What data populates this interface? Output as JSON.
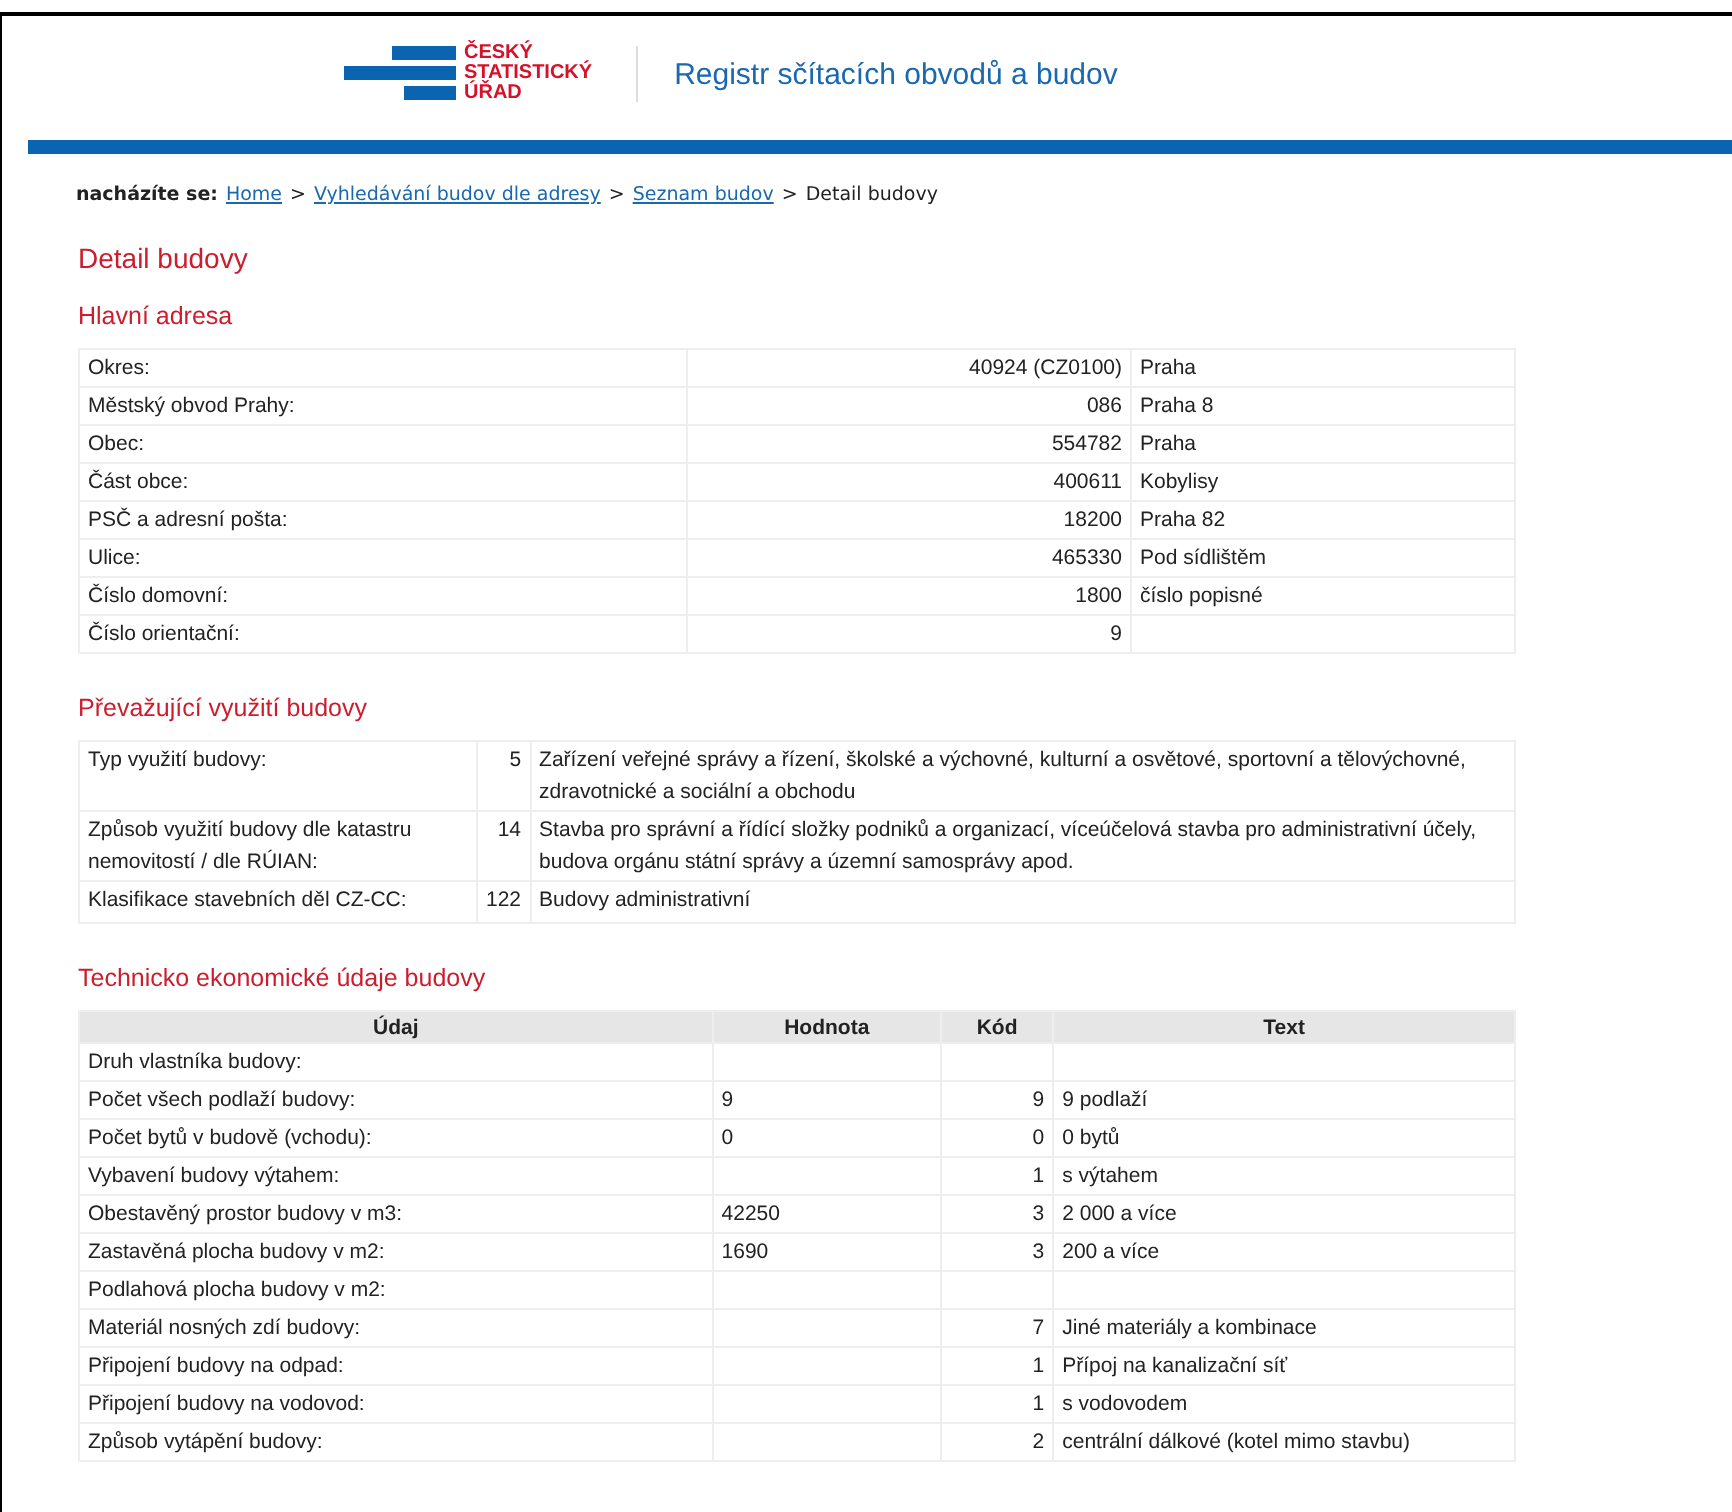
{
  "header": {
    "logo_lines": [
      "ČESKÝ",
      "STATISTICKÝ",
      "ÚŘAD"
    ],
    "title": "Registr sčítacích obvodů a budov"
  },
  "breadcrumb": {
    "label": "nacházíte se:",
    "links": [
      "Home",
      "Vyhledávání budov dle adresy",
      "Seznam budov"
    ],
    "separator": ">",
    "current": "Detail budovy"
  },
  "page_title": "Detail budovy",
  "address": {
    "title": "Hlavní adresa",
    "rows": [
      {
        "label": "Okres:",
        "code": "40924 (CZ0100)",
        "text": "Praha"
      },
      {
        "label": "Městský obvod Prahy:",
        "code": "086",
        "text": "Praha 8"
      },
      {
        "label": "Obec:",
        "code": "554782",
        "text": "Praha"
      },
      {
        "label": "Část obce:",
        "code": "400611",
        "text": "Kobylisy"
      },
      {
        "label": "PSČ a adresní pošta:",
        "code": "18200",
        "text": "Praha 82"
      },
      {
        "label": "Ulice:",
        "code": "465330",
        "text": "Pod sídlištěm"
      },
      {
        "label": "Číslo domovní:",
        "code": "1800",
        "text": "číslo popisné"
      },
      {
        "label": "Číslo orientační:",
        "code": "9",
        "text": ""
      }
    ]
  },
  "usage": {
    "title": "Převažující využití budovy",
    "rows": [
      {
        "label": "Typ využití budovy:",
        "code": "5",
        "text": "Zařízení veřejné správy a řízení, školské a výchovné, kulturní a osvětové, sportovní a tělovýchovné, zdravotnické a sociální a obchodu"
      },
      {
        "label": "Způsob využití budovy dle katastru nemovitostí / dle RÚIAN:",
        "code": "14",
        "text": "Stavba pro správní a řídící složky podniků a organizací, víceúčelová stavba pro administrativní účely, budova orgánu státní správy a územní samosprávy apod."
      },
      {
        "label": "Klasifikace stavebních děl CZ-CC:",
        "code": "122",
        "text": "Budovy administrativní"
      }
    ]
  },
  "technical": {
    "title": "Technicko ekonomické údaje budovy",
    "columns": [
      "Údaj",
      "Hodnota",
      "Kód",
      "Text"
    ],
    "rows": [
      [
        "Druh vlastníka budovy:",
        "",
        "",
        ""
      ],
      [
        "Počet všech podlaží budovy:",
        "9",
        "9",
        "9 podlaží"
      ],
      [
        "Počet bytů v budově (vchodu):",
        "0",
        "0",
        "0 bytů"
      ],
      [
        "Vybavení budovy výtahem:",
        "",
        "1",
        "s výtahem"
      ],
      [
        "Obestavěný prostor budovy v m3:",
        "42250",
        "3",
        "2 000 a více"
      ],
      [
        "Zastavěná plocha budovy v m2:",
        "1690",
        "3",
        "200 a více"
      ],
      [
        "Podlahová plocha budovy v m2:",
        "",
        "",
        ""
      ],
      [
        "Materiál nosných zdí budovy:",
        "",
        "7",
        "Jiné materiály a kombinace"
      ],
      [
        "Připojení budovy na odpad:",
        "",
        "1",
        "Přípoj na kanalizační síť"
      ],
      [
        "Připojení budovy na vodovod:",
        "",
        "1",
        "s vodovodem"
      ],
      [
        "Způsob vytápění budovy:",
        "",
        "2",
        "centrální dálkové (kotel mimo stavbu)"
      ]
    ]
  }
}
